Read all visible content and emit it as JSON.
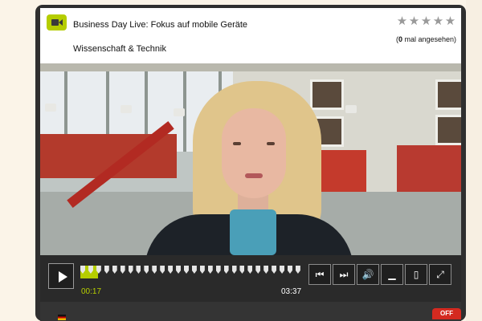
{
  "header": {
    "title": "Business Day Live: Fokus auf mobile Geräte",
    "category": "Wissenschaft & Technik",
    "views_count": "0",
    "views_suffix": " mal angesehen)",
    "views_prefix": "(",
    "rating_stars": 5,
    "icon": "video-camera-icon"
  },
  "player": {
    "current_time": "00:17",
    "duration": "03:37",
    "progress": 0.08,
    "accent_color": "#b5cd00",
    "buttons": [
      "play-icon",
      "previous-icon",
      "next-icon",
      "volume-icon",
      "subtitles-icon",
      "popout-icon",
      "fullscreen-icon"
    ]
  },
  "footer": {
    "toggle_label": "OFF",
    "flag": "german-flag-icon"
  }
}
